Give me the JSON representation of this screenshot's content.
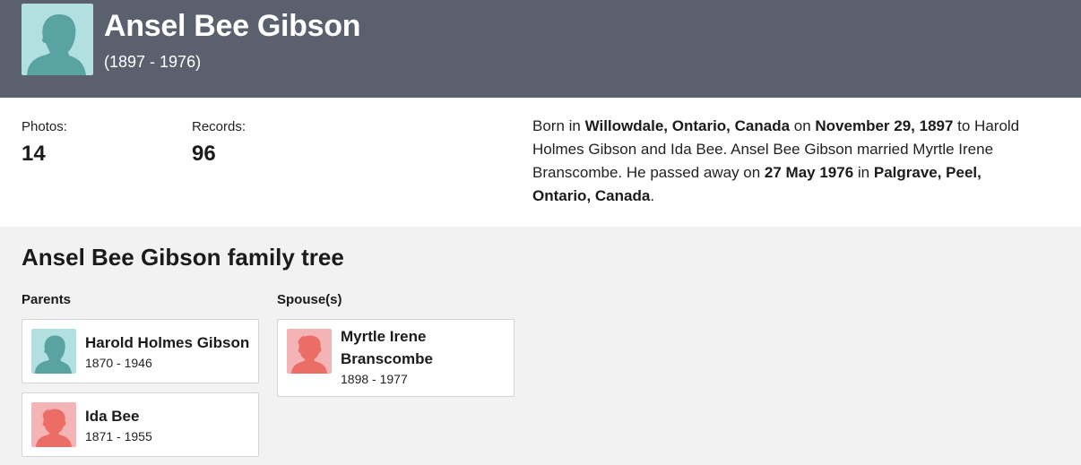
{
  "person": {
    "name": "Ansel Bee Gibson",
    "dates": "(1897 - 1976)"
  },
  "stats": {
    "photos_label": "Photos:",
    "photos_value": "14",
    "records_label": "Records:",
    "records_value": "96"
  },
  "bio": {
    "born_prefix": "Born in ",
    "birth_place": "Willowdale, Ontario, Canada",
    "on1": " on ",
    "birth_date": "November 29, 1897",
    "parents_text": " to Harold Holmes Gibson and Ida Bee. Ansel Bee Gibson married Myrtle Irene Branscombe. He passed away on ",
    "death_date": "27 May 1976",
    "in2": " in ",
    "death_place": "Palgrave, Peel, Ontario, Canada",
    "end": "."
  },
  "tree": {
    "title": "Ansel Bee Gibson family tree",
    "parents_label": "Parents",
    "spouses_label": "Spouse(s)",
    "parents": [
      {
        "name": "Harold Holmes Gibson",
        "dates": "1870 - 1946",
        "gender": "male"
      },
      {
        "name": "Ida Bee",
        "dates": "1871 - 1955",
        "gender": "female"
      }
    ],
    "spouses": [
      {
        "name": "Myrtle Irene Branscombe",
        "dates": "1898 - 1977",
        "gender": "female"
      }
    ]
  },
  "colors": {
    "header_bg": "#5b606e",
    "male_avatar_bg": "#b2dfe0",
    "male_silhouette": "#5aa3a3",
    "female_avatar_bg": "#f4b3b5",
    "female_silhouette": "#ea6d66",
    "page_bg": "#f2f2f2"
  }
}
